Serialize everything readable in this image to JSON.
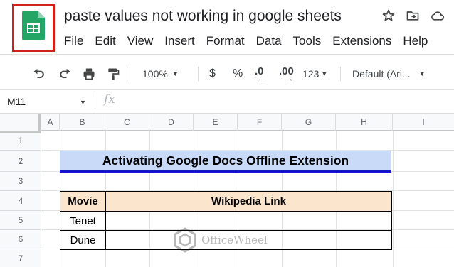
{
  "document": {
    "title": "paste values not working in google sheets"
  },
  "menu": [
    "File",
    "Edit",
    "View",
    "Insert",
    "Format",
    "Data",
    "Tools",
    "Extensions",
    "Help"
  ],
  "toolbar": {
    "zoom": "100%",
    "currency": "$",
    "percent": "%",
    "decrease_decimal": ".0",
    "increase_decimal": ".00",
    "number_format": "123",
    "font": "Default (Ari..."
  },
  "formula_bar": {
    "cell_reference": "M11",
    "fx_label": "fx"
  },
  "columns": [
    "A",
    "B",
    "C",
    "D",
    "E",
    "F",
    "G",
    "H",
    "I"
  ],
  "rows": [
    "1",
    "2",
    "3",
    "4",
    "5",
    "6",
    "7"
  ],
  "sheet": {
    "banner_title": "Activating Google Docs Offline Extension",
    "table": {
      "headers": [
        "Movie",
        "Wikipedia Link"
      ],
      "rows": [
        [
          "Tenet",
          ""
        ],
        [
          "Dune",
          ""
        ]
      ]
    },
    "watermark": "OfficeWheel"
  },
  "colors": {
    "logo_highlight": "#d0211c",
    "sheets_green": "#23a566",
    "banner_fill": "#c9daf8",
    "banner_underline": "#1414c8",
    "table_header_fill": "#fce5cd"
  }
}
